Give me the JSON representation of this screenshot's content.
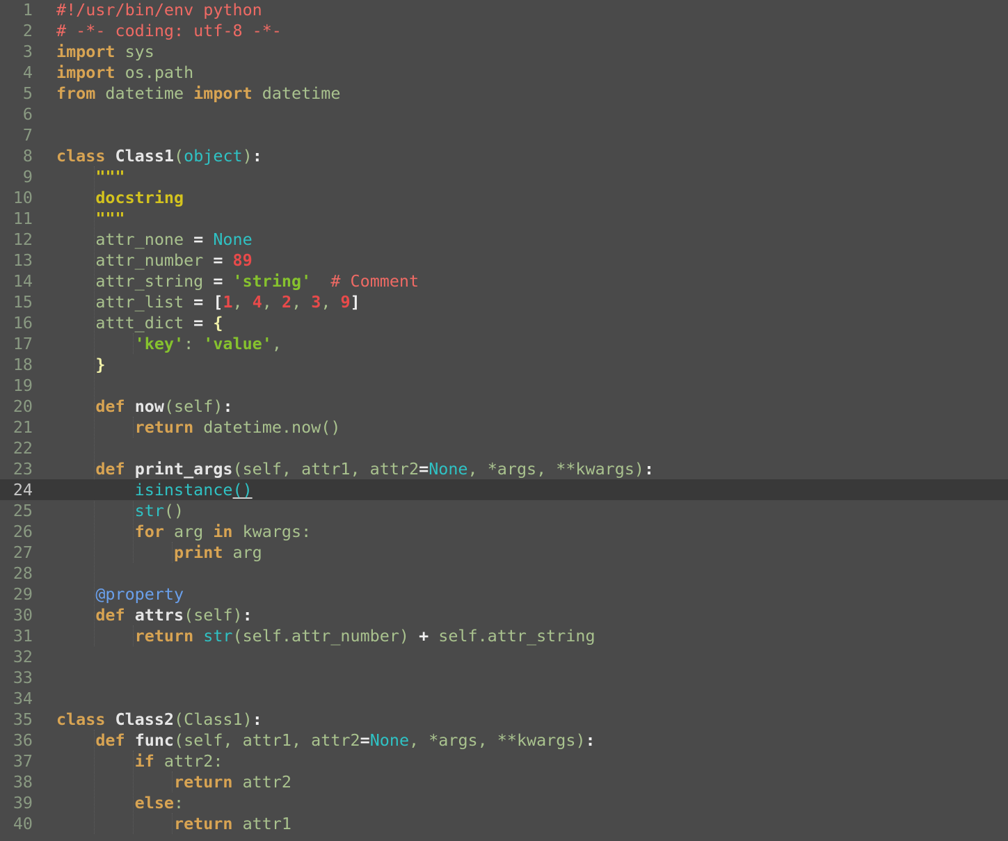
{
  "editor": {
    "current_line": 24,
    "lines": [
      {
        "n": "1",
        "tokens": [
          {
            "t": "#!/usr/bin/env python",
            "c": "comment"
          }
        ]
      },
      {
        "n": "2",
        "tokens": [
          {
            "t": "# -*- coding: utf-8 -*-",
            "c": "comment"
          }
        ]
      },
      {
        "n": "3",
        "tokens": [
          {
            "t": "import",
            "c": "kw"
          },
          {
            "t": " sys",
            "c": "plain"
          }
        ]
      },
      {
        "n": "4",
        "tokens": [
          {
            "t": "import",
            "c": "kw"
          },
          {
            "t": " os.path",
            "c": "plain"
          }
        ]
      },
      {
        "n": "5",
        "tokens": [
          {
            "t": "from",
            "c": "kw"
          },
          {
            "t": " datetime ",
            "c": "plain"
          },
          {
            "t": "import",
            "c": "kw"
          },
          {
            "t": " datetime",
            "c": "plain"
          }
        ]
      },
      {
        "n": "6",
        "tokens": []
      },
      {
        "n": "7",
        "tokens": []
      },
      {
        "n": "8",
        "tokens": [
          {
            "t": "class",
            "c": "kw"
          },
          {
            "t": " ",
            "c": "plain"
          },
          {
            "t": "Class1",
            "c": "name"
          },
          {
            "t": "(",
            "c": "punct"
          },
          {
            "t": "object",
            "c": "builtin"
          },
          {
            "t": ")",
            "c": "punct"
          },
          {
            "t": ":",
            "c": "op"
          }
        ]
      },
      {
        "n": "9",
        "tokens": [
          {
            "t": "    ",
            "c": "plain"
          },
          {
            "t": "\"\"\"",
            "c": "doc"
          }
        ]
      },
      {
        "n": "10",
        "tokens": [
          {
            "t": "    ",
            "c": "plain"
          },
          {
            "t": "docstring",
            "c": "doc"
          }
        ]
      },
      {
        "n": "11",
        "tokens": [
          {
            "t": "    ",
            "c": "plain"
          },
          {
            "t": "\"\"\"",
            "c": "doc"
          }
        ]
      },
      {
        "n": "12",
        "tokens": [
          {
            "t": "    attr_none ",
            "c": "plain"
          },
          {
            "t": "=",
            "c": "op"
          },
          {
            "t": " ",
            "c": "plain"
          },
          {
            "t": "None",
            "c": "const"
          }
        ]
      },
      {
        "n": "13",
        "tokens": [
          {
            "t": "    attr_number ",
            "c": "plain"
          },
          {
            "t": "=",
            "c": "op"
          },
          {
            "t": " ",
            "c": "plain"
          },
          {
            "t": "89",
            "c": "num"
          }
        ]
      },
      {
        "n": "14",
        "tokens": [
          {
            "t": "    attr_string ",
            "c": "plain"
          },
          {
            "t": "=",
            "c": "op"
          },
          {
            "t": " ",
            "c": "plain"
          },
          {
            "t": "'string'",
            "c": "str"
          },
          {
            "t": "  ",
            "c": "plain"
          },
          {
            "t": "# Comment",
            "c": "comment"
          }
        ]
      },
      {
        "n": "15",
        "tokens": [
          {
            "t": "    attr_list ",
            "c": "plain"
          },
          {
            "t": "=",
            "c": "op"
          },
          {
            "t": " ",
            "c": "plain"
          },
          {
            "t": "[",
            "c": "bracket"
          },
          {
            "t": "1",
            "c": "num"
          },
          {
            "t": ", ",
            "c": "punct"
          },
          {
            "t": "4",
            "c": "num"
          },
          {
            "t": ", ",
            "c": "punct"
          },
          {
            "t": "2",
            "c": "num"
          },
          {
            "t": ", ",
            "c": "punct"
          },
          {
            "t": "3",
            "c": "num"
          },
          {
            "t": ", ",
            "c": "punct"
          },
          {
            "t": "9",
            "c": "num"
          },
          {
            "t": "]",
            "c": "bracket"
          }
        ]
      },
      {
        "n": "16",
        "tokens": [
          {
            "t": "    attt_dict ",
            "c": "plain"
          },
          {
            "t": "=",
            "c": "op"
          },
          {
            "t": " ",
            "c": "plain"
          },
          {
            "t": "{",
            "c": "brace"
          }
        ]
      },
      {
        "n": "17",
        "tokens": [
          {
            "t": "        ",
            "c": "plain"
          },
          {
            "t": "'key'",
            "c": "str"
          },
          {
            "t": ": ",
            "c": "punct"
          },
          {
            "t": "'value'",
            "c": "str"
          },
          {
            "t": ",",
            "c": "punct"
          }
        ]
      },
      {
        "n": "18",
        "tokens": [
          {
            "t": "    ",
            "c": "plain"
          },
          {
            "t": "}",
            "c": "brace"
          }
        ]
      },
      {
        "n": "19",
        "tokens": []
      },
      {
        "n": "20",
        "tokens": [
          {
            "t": "    ",
            "c": "plain"
          },
          {
            "t": "def",
            "c": "kw"
          },
          {
            "t": " ",
            "c": "plain"
          },
          {
            "t": "now",
            "c": "name"
          },
          {
            "t": "(self)",
            "c": "plain"
          },
          {
            "t": ":",
            "c": "op"
          }
        ]
      },
      {
        "n": "21",
        "tokens": [
          {
            "t": "        ",
            "c": "plain"
          },
          {
            "t": "return",
            "c": "kw"
          },
          {
            "t": " datetime.now()",
            "c": "plain"
          }
        ]
      },
      {
        "n": "22",
        "tokens": []
      },
      {
        "n": "23",
        "tokens": [
          {
            "t": "    ",
            "c": "plain"
          },
          {
            "t": "def",
            "c": "kw"
          },
          {
            "t": " ",
            "c": "plain"
          },
          {
            "t": "print_args",
            "c": "name"
          },
          {
            "t": "(self, attr1, attr2",
            "c": "plain"
          },
          {
            "t": "=",
            "c": "op"
          },
          {
            "t": "None",
            "c": "const"
          },
          {
            "t": ", *args, **kwargs)",
            "c": "plain"
          },
          {
            "t": ":",
            "c": "op"
          }
        ]
      },
      {
        "n": "24",
        "tokens": [
          {
            "t": "        ",
            "c": "plain"
          },
          {
            "t": "isinstance",
            "c": "builtin"
          },
          {
            "t": "()",
            "c": "match"
          }
        ]
      },
      {
        "n": "25",
        "tokens": [
          {
            "t": "        ",
            "c": "plain"
          },
          {
            "t": "str",
            "c": "builtin"
          },
          {
            "t": "()",
            "c": "plain"
          }
        ]
      },
      {
        "n": "26",
        "tokens": [
          {
            "t": "        ",
            "c": "plain"
          },
          {
            "t": "for",
            "c": "kw"
          },
          {
            "t": " arg ",
            "c": "plain"
          },
          {
            "t": "in",
            "c": "kw"
          },
          {
            "t": " kwargs:",
            "c": "plain"
          }
        ]
      },
      {
        "n": "27",
        "tokens": [
          {
            "t": "            ",
            "c": "plain"
          },
          {
            "t": "print",
            "c": "kw"
          },
          {
            "t": " arg",
            "c": "plain"
          }
        ]
      },
      {
        "n": "28",
        "tokens": []
      },
      {
        "n": "29",
        "tokens": [
          {
            "t": "    ",
            "c": "plain"
          },
          {
            "t": "@property",
            "c": "deco"
          }
        ]
      },
      {
        "n": "30",
        "tokens": [
          {
            "t": "    ",
            "c": "plain"
          },
          {
            "t": "def",
            "c": "kw"
          },
          {
            "t": " ",
            "c": "plain"
          },
          {
            "t": "attrs",
            "c": "name"
          },
          {
            "t": "(self)",
            "c": "plain"
          },
          {
            "t": ":",
            "c": "op"
          }
        ]
      },
      {
        "n": "31",
        "tokens": [
          {
            "t": "        ",
            "c": "plain"
          },
          {
            "t": "return",
            "c": "kw"
          },
          {
            "t": " ",
            "c": "plain"
          },
          {
            "t": "str",
            "c": "builtin"
          },
          {
            "t": "(self.attr_number) ",
            "c": "plain"
          },
          {
            "t": "+",
            "c": "op"
          },
          {
            "t": " self.attr_string",
            "c": "plain"
          }
        ]
      },
      {
        "n": "32",
        "tokens": []
      },
      {
        "n": "33",
        "tokens": []
      },
      {
        "n": "34",
        "tokens": []
      },
      {
        "n": "35",
        "tokens": [
          {
            "t": "class",
            "c": "kw"
          },
          {
            "t": " ",
            "c": "plain"
          },
          {
            "t": "Class2",
            "c": "name"
          },
          {
            "t": "(Class1)",
            "c": "plain"
          },
          {
            "t": ":",
            "c": "op"
          }
        ]
      },
      {
        "n": "36",
        "tokens": [
          {
            "t": "    ",
            "c": "plain"
          },
          {
            "t": "def",
            "c": "kw"
          },
          {
            "t": " ",
            "c": "plain"
          },
          {
            "t": "func",
            "c": "name"
          },
          {
            "t": "(self, attr1, attr2",
            "c": "plain"
          },
          {
            "t": "=",
            "c": "op"
          },
          {
            "t": "None",
            "c": "const"
          },
          {
            "t": ", *args, **kwargs)",
            "c": "plain"
          },
          {
            "t": ":",
            "c": "op"
          }
        ]
      },
      {
        "n": "37",
        "tokens": [
          {
            "t": "        ",
            "c": "plain"
          },
          {
            "t": "if",
            "c": "kw"
          },
          {
            "t": " attr2:",
            "c": "plain"
          }
        ]
      },
      {
        "n": "38",
        "tokens": [
          {
            "t": "            ",
            "c": "plain"
          },
          {
            "t": "return",
            "c": "kw"
          },
          {
            "t": " attr2",
            "c": "plain"
          }
        ]
      },
      {
        "n": "39",
        "tokens": [
          {
            "t": "        ",
            "c": "plain"
          },
          {
            "t": "else",
            "c": "kw"
          },
          {
            "t": ":",
            "c": "plain"
          }
        ]
      },
      {
        "n": "40",
        "tokens": [
          {
            "t": "            ",
            "c": "plain"
          },
          {
            "t": "return",
            "c": "kw"
          },
          {
            "t": " attr1",
            "c": "plain"
          }
        ]
      }
    ]
  }
}
